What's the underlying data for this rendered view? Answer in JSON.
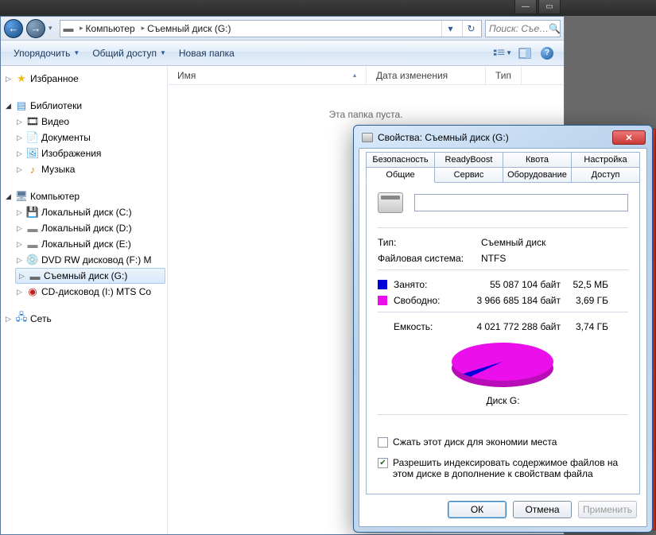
{
  "taskbar": {
    "min": "—",
    "max": "▭",
    "close": "✕"
  },
  "nav": {
    "back": "←",
    "forward": "→",
    "segments": [
      "Компьютер",
      "Съемный диск (G:)"
    ],
    "refresh": "↻",
    "search_placeholder": "Поиск: Съе…"
  },
  "toolbar": {
    "organize": "Упорядочить",
    "share": "Общий доступ",
    "new_folder": "Новая папка"
  },
  "tree": {
    "favorites": "Избранное",
    "libraries": "Библиотеки",
    "lib_items": [
      "Видео",
      "Документы",
      "Изображения",
      "Музыка"
    ],
    "computer": "Компьютер",
    "drives": [
      "Локальный диск (C:)",
      "Локальный диск (D:)",
      "Локальный диск (E:)",
      "DVD RW дисковод (F:) M",
      "Съемный диск (G:)",
      "CD-дисковод (I:) MTS Co"
    ],
    "network": "Сеть"
  },
  "columns": {
    "name": "Имя",
    "date": "Дата изменения",
    "type": "Тип"
  },
  "content": {
    "empty": "Эта папка пуста."
  },
  "props": {
    "title": "Свойства: Съемный диск (G:)",
    "tabs_row1": [
      "Безопасность",
      "ReadyBoost",
      "Квота",
      "Настройка"
    ],
    "tabs_row2": [
      "Общие",
      "Сервис",
      "Оборудование",
      "Доступ"
    ],
    "name_value": "",
    "type_label": "Тип:",
    "type_value": "Съемный диск",
    "fs_label": "Файловая система:",
    "fs_value": "NTFS",
    "used_label": "Занято:",
    "used_bytes": "55 087 104 байт",
    "used_hr": "52,5 МБ",
    "free_label": "Свободно:",
    "free_bytes": "3 966 685 184 байт",
    "free_hr": "3,69 ГБ",
    "cap_label": "Емкость:",
    "cap_bytes": "4 021 772 288 байт",
    "cap_hr": "3,74 ГБ",
    "pie_label": "Диск G:",
    "compress": "Сжать этот диск для экономии места",
    "index": "Разрешить индексировать содержимое файлов на этом диске в дополнение к свойствам файла",
    "ok": "ОК",
    "cancel": "Отмена",
    "apply": "Применить"
  },
  "chart_data": {
    "type": "pie",
    "title": "Диск G:",
    "series": [
      {
        "name": "Занято",
        "value": 55087104,
        "color": "#0000d8"
      },
      {
        "name": "Свободно",
        "value": 3966685184,
        "color": "#eb0feb"
      }
    ],
    "total": 4021772288
  }
}
